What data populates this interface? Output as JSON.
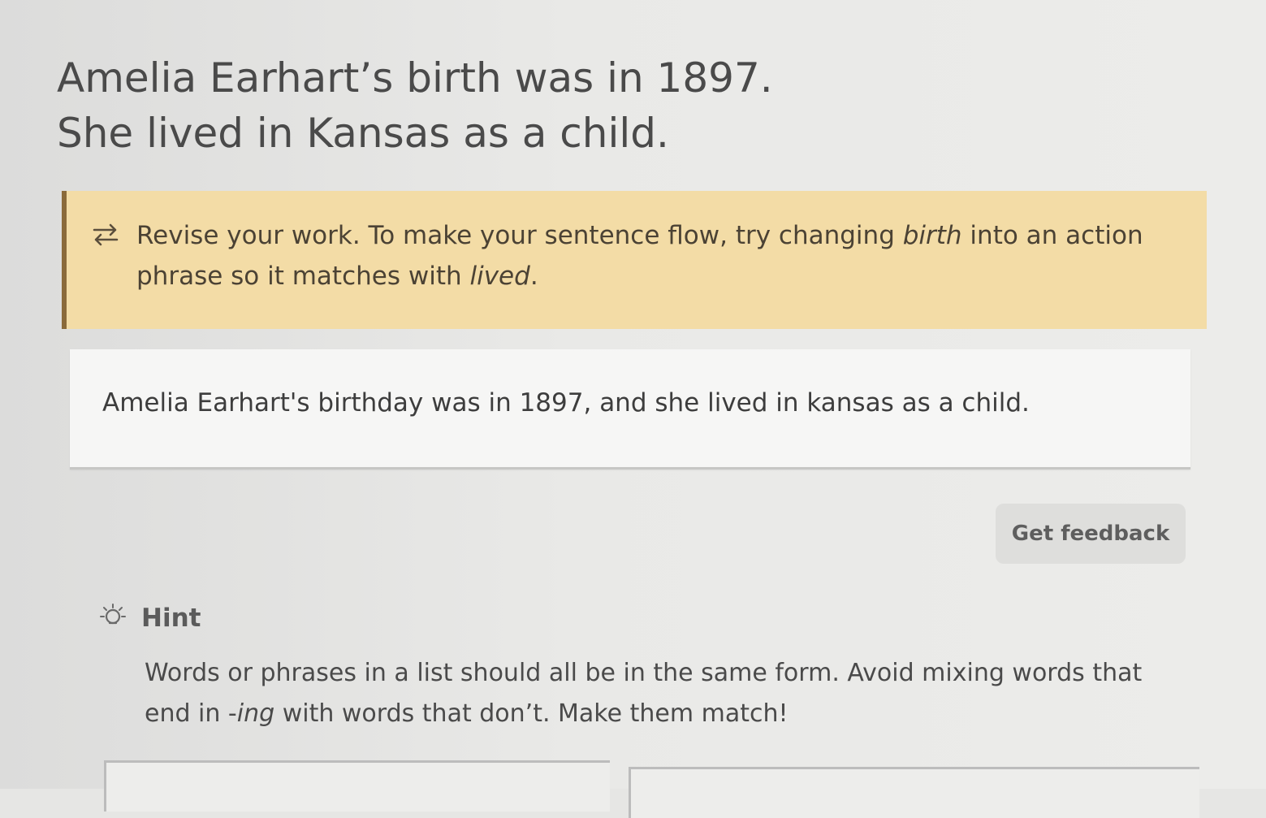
{
  "prompt": {
    "line1": "Amelia Earhart’s birth was in 1897.",
    "line2": "She lived in Kansas as a child."
  },
  "feedback": {
    "icon": "revise-arrows-icon",
    "part1": "Revise your work. To make your sentence flow, try changing ",
    "em1": "birth",
    "part2": " into an action phrase so it matches with ",
    "em2": "lived",
    "part3": "."
  },
  "answer": {
    "value": "Amelia Earhart's birthday was in 1897, and she lived in kansas as a child."
  },
  "actions": {
    "get_feedback_label": "Get feedback"
  },
  "hint": {
    "icon": "lightbulb-icon",
    "label": "Hint",
    "part1": "Words or phrases in a list should all be in the same form. Avoid mixing words that end in -",
    "em": "ing",
    "part2": " with words that don’t. Make them match!"
  },
  "colors": {
    "feedback_bg": "#f3dca6",
    "feedback_border": "#8a6a3a",
    "button_bg": "#dededc"
  }
}
